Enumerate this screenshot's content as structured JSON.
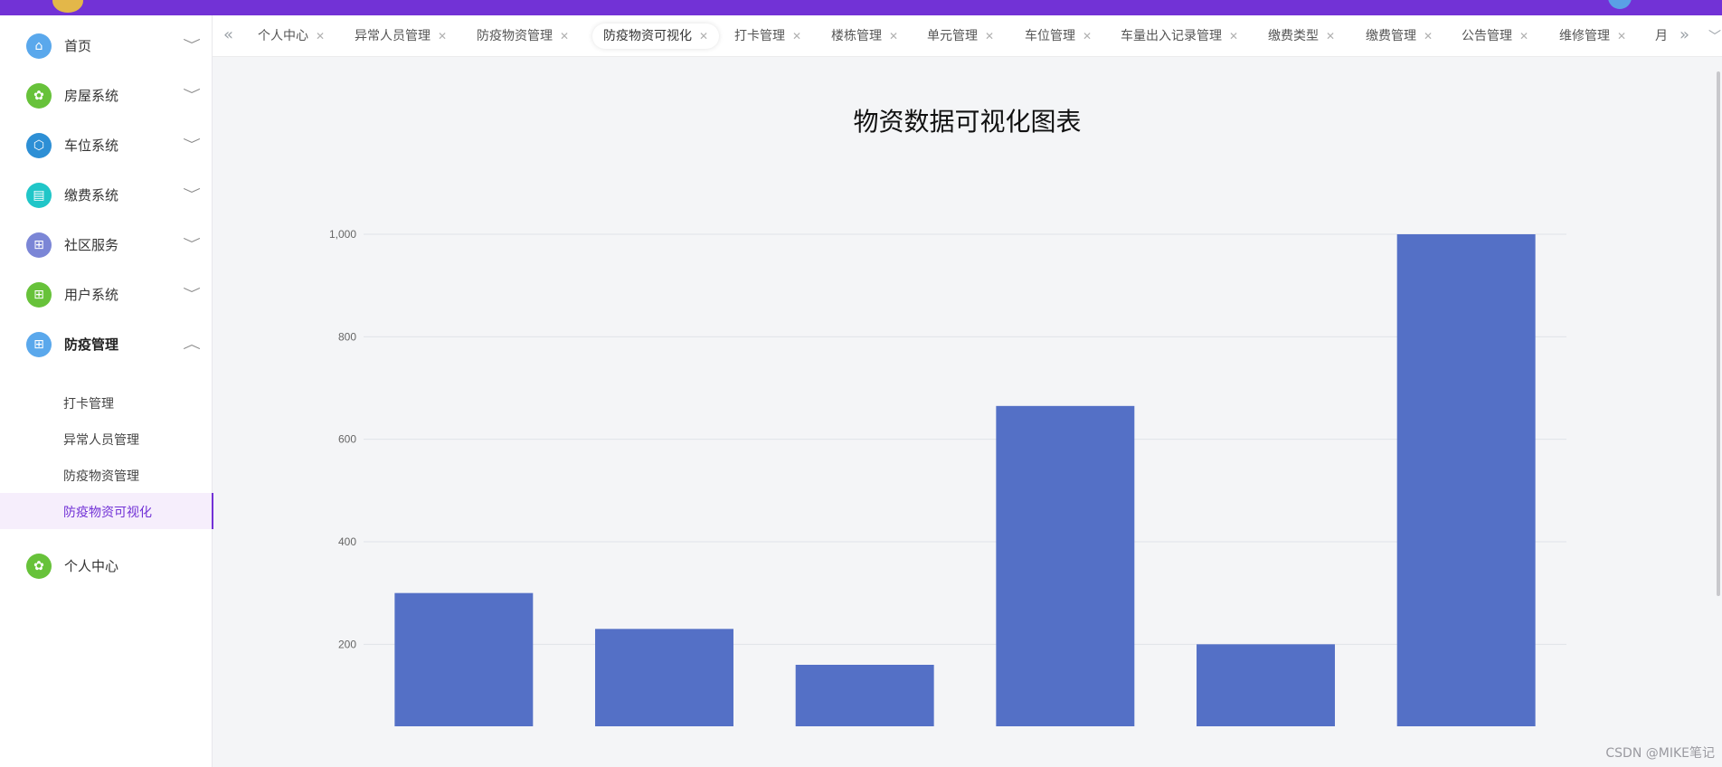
{
  "colors": {
    "accent": "#7232d6",
    "bar": "#5470c6"
  },
  "sidebar": {
    "items": [
      {
        "label": "首页",
        "icon": "home-icon",
        "color": "#5aa8ec",
        "glyph": "⌂"
      },
      {
        "label": "房屋系统",
        "icon": "gear-icon",
        "color": "#67c23a",
        "glyph": "✿"
      },
      {
        "label": "车位系统",
        "icon": "cube-icon",
        "color": "#2d8fd5",
        "glyph": "⬡"
      },
      {
        "label": "缴费系统",
        "icon": "book-icon",
        "color": "#20c6c8",
        "glyph": "▤"
      },
      {
        "label": "社区服务",
        "icon": "apps-icon",
        "color": "#7b86d6",
        "glyph": "⊞"
      },
      {
        "label": "用户系统",
        "icon": "apps-icon",
        "color": "#67c23a",
        "glyph": "⊞"
      },
      {
        "label": "防疫管理",
        "icon": "apps-icon",
        "color": "#5aa8ec",
        "glyph": "⊞"
      }
    ],
    "subitems": [
      "打卡管理",
      "异常人员管理",
      "防疫物资管理",
      "防疫物资可视化"
    ],
    "last": {
      "label": "个人中心",
      "icon": "gear-icon",
      "color": "#67c23a",
      "glyph": "✿"
    }
  },
  "tabs": [
    "个人中心",
    "异常人员管理",
    "防疫物资管理",
    "防疫物资可视化",
    "打卡管理",
    "楼栋管理",
    "单元管理",
    "车位管理",
    "车量出入记录管理",
    "缴费类型",
    "缴费管理",
    "公告管理",
    "维修管理",
    "月"
  ],
  "tabs_active": 3,
  "chart_data": {
    "type": "bar",
    "title": "物资数据可视化图表",
    "values": [
      300,
      230,
      160,
      665,
      200,
      1000
    ],
    "ylim": [
      40,
      1000
    ],
    "yticks": [
      200,
      400,
      600,
      800,
      1000
    ],
    "ytick_labels": [
      "200",
      "400",
      "600",
      "800",
      "1,000"
    ],
    "grid": true
  },
  "watermark": "CSDN @MIKE笔记"
}
